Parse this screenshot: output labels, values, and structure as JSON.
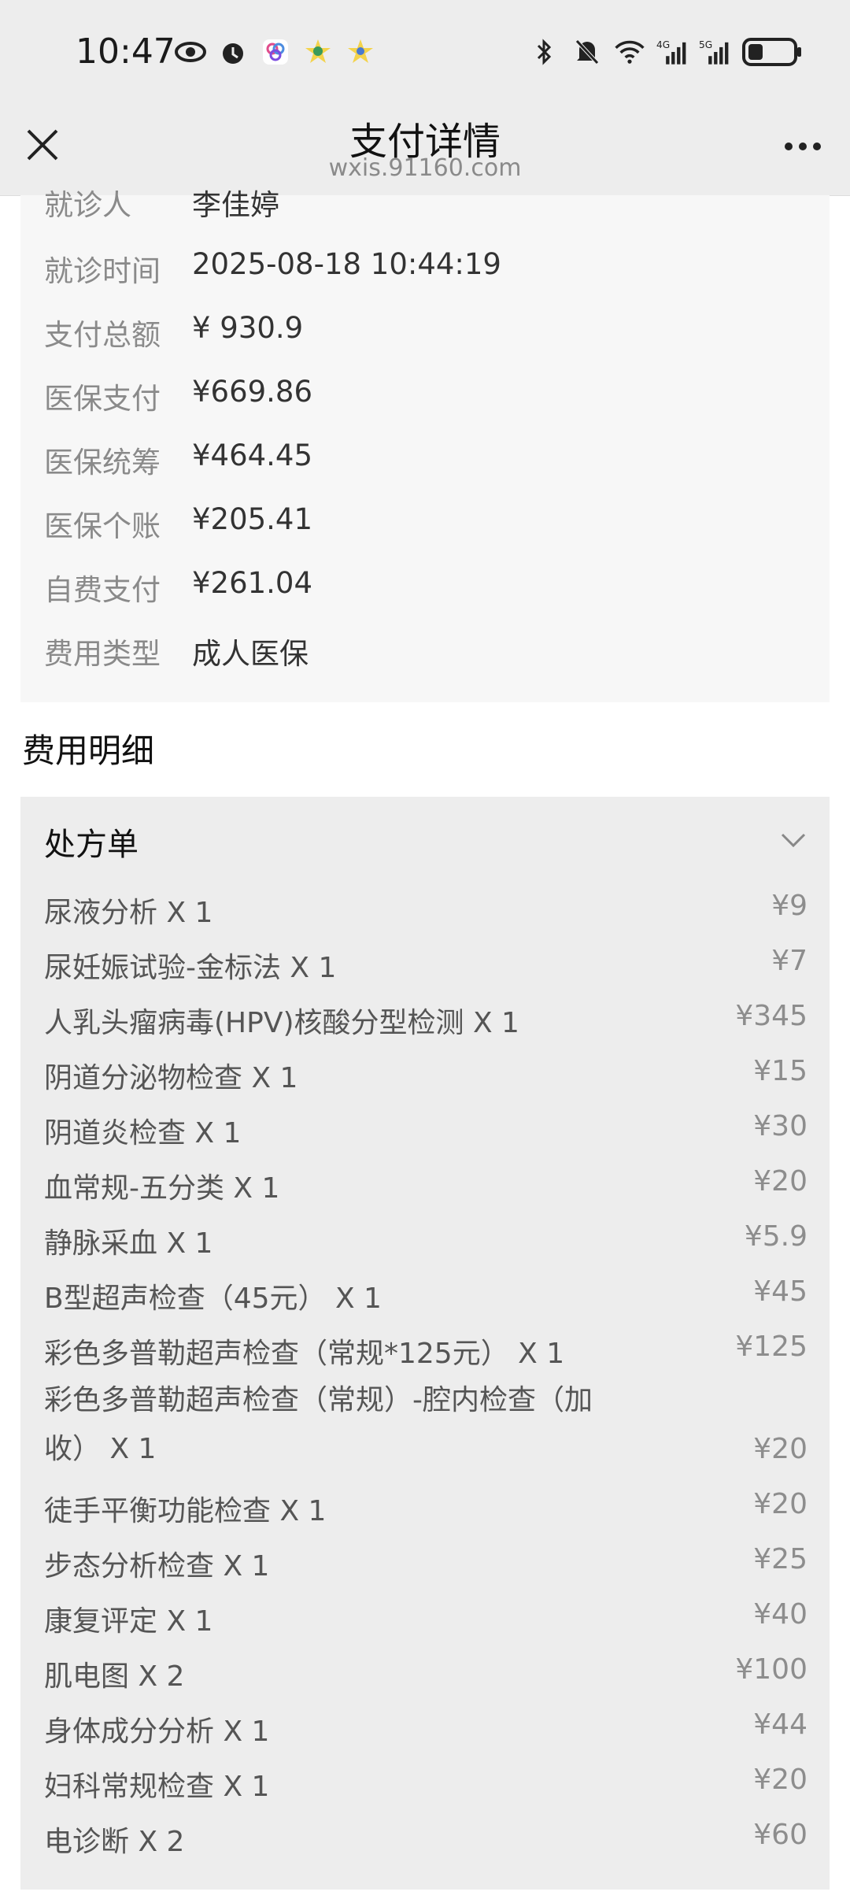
{
  "status_bar": {
    "time": "10:47",
    "left_icons": [
      "eye-icon",
      "alarm-icon",
      "app-icon",
      "star-badge-icon",
      "star-badge-icon"
    ],
    "right_icons": [
      "bluetooth-icon",
      "mute-icon",
      "wifi-icon",
      "4g-signal-icon",
      "5g-signal-icon",
      "battery-icon"
    ]
  },
  "header": {
    "title": "支付详情",
    "subtitle": "wxis.91160.com"
  },
  "info": {
    "rows": [
      {
        "label": "就诊人",
        "value": "李佳婷"
      },
      {
        "label": "就诊时间",
        "value": "2025-08-18 10:44:19"
      },
      {
        "label": "支付总额",
        "value": "¥ 930.9"
      },
      {
        "label": "医保支付",
        "value": "¥669.86"
      },
      {
        "label": "医保统筹",
        "value": "¥464.45"
      },
      {
        "label": "医保个账",
        "value": "¥205.41"
      },
      {
        "label": "自费支付",
        "value": "¥261.04"
      },
      {
        "label": "费用类型",
        "value": "成人医保"
      }
    ]
  },
  "details": {
    "section_title": "费用明细",
    "card_title": "处方单",
    "items": [
      {
        "name": "尿液分析 X 1",
        "price": "¥9"
      },
      {
        "name": "尿妊娠试验-金标法 X 1",
        "price": "¥7"
      },
      {
        "name": "人乳头瘤病毒(HPV)核酸分型检测 X 1",
        "price": "¥345"
      },
      {
        "name": "阴道分泌物检查 X 1",
        "price": "¥15"
      },
      {
        "name": "阴道炎检查 X 1",
        "price": "¥30"
      },
      {
        "name": "血常规-五分类 X 1",
        "price": "¥20"
      },
      {
        "name": "静脉采血 X 1",
        "price": "¥5.9"
      },
      {
        "name": "B型超声检查（45元） X 1",
        "price": "¥45"
      },
      {
        "name": "彩色多普勒超声检查（常规*125元） X 1",
        "price": "¥125"
      },
      {
        "name": "彩色多普勒超声检查（常规）-腔内检查（加收） X 1",
        "price": "¥20"
      },
      {
        "name": "徒手平衡功能检查 X 1",
        "price": "¥20"
      },
      {
        "name": "步态分析检查 X 1",
        "price": "¥25"
      },
      {
        "name": "康复评定 X 1",
        "price": "¥40"
      },
      {
        "name": "肌电图 X 2",
        "price": "¥100"
      },
      {
        "name": "身体成分分析 X 1",
        "price": "¥44"
      },
      {
        "name": "妇科常规检查 X 1",
        "price": "¥20"
      },
      {
        "name": "电诊断 X 2",
        "price": "¥60"
      }
    ]
  }
}
